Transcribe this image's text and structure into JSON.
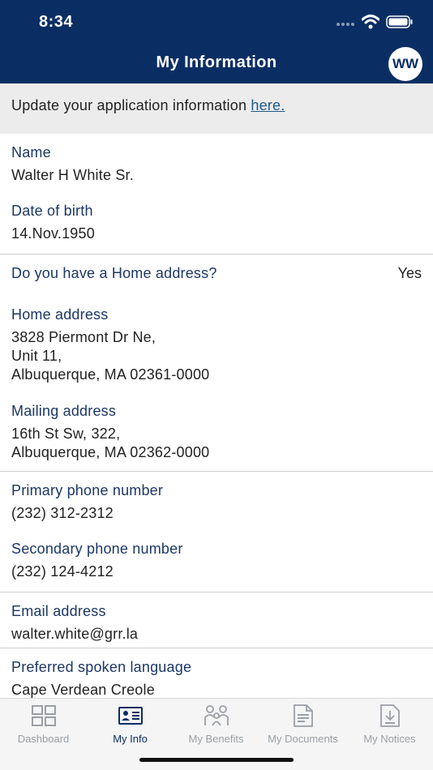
{
  "status_bar": {
    "time": "8:34"
  },
  "header": {
    "title": "My Information",
    "avatar_initials": "WW"
  },
  "banner": {
    "text": "Update your application information ",
    "link": "here."
  },
  "personal": {
    "name_label": "Name",
    "name_value": "Walter H White Sr.",
    "dob_label": "Date of birth",
    "dob_value": "14.Nov.1950"
  },
  "address": {
    "question": "Do you have a Home address?",
    "answer": "Yes",
    "home_label": "Home address",
    "home_line1": "3828 Piermont Dr Ne,",
    "home_line2": "Unit 11,",
    "home_line3": "Albuquerque,  MA 02361-0000",
    "mailing_label": "Mailing address",
    "mailing_line1": "16th St Sw, 322,",
    "mailing_line2": "Albuquerque,  MA 02362-0000"
  },
  "phones": {
    "primary_label": "Primary phone number",
    "primary_value": "(232) 312-2312",
    "secondary_label": "Secondary phone number",
    "secondary_value": "(232) 124-4212"
  },
  "email": {
    "label": "Email address",
    "value": "walter.white@grr.la"
  },
  "language": {
    "label": "Preferred spoken language",
    "value": "Cape Verdean Creole"
  },
  "tabs": [
    {
      "label": "Dashboard",
      "icon": "grid-icon"
    },
    {
      "label": "My Info",
      "icon": "id-card-icon",
      "active": true
    },
    {
      "label": "My Benefits",
      "icon": "family-icon"
    },
    {
      "label": "My Documents",
      "icon": "document-icon"
    },
    {
      "label": "My Notices",
      "icon": "download-notice-icon"
    }
  ],
  "colors": {
    "header": "#0a2e63",
    "label": "#1c3766",
    "link": "#1f5a8a"
  }
}
